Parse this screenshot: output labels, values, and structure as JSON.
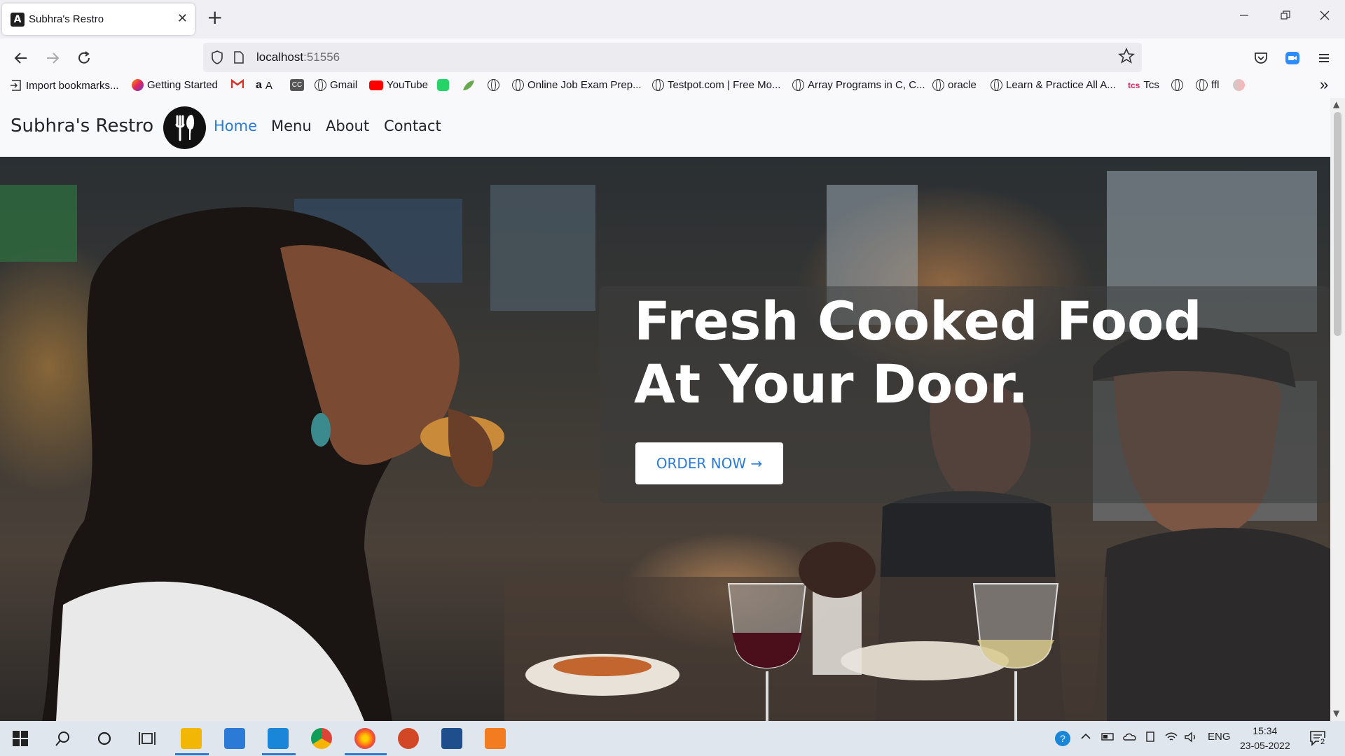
{
  "browser": {
    "tab_title": "Subhra's Restro",
    "tab_close": "✕",
    "new_tab": "+",
    "url_host": "localhost",
    "url_port": ":51556",
    "bookmarks": [
      {
        "label": "Import bookmarks...",
        "icon": "import-icon"
      },
      {
        "label": "Getting Started",
        "icon": "firefox-icon"
      },
      {
        "label": "",
        "icon": "gmail-icon"
      },
      {
        "label": "A",
        "icon": "amazon-icon"
      },
      {
        "label": "",
        "icon": "cc-icon"
      },
      {
        "label": "Gmail",
        "icon": "globe-icon"
      },
      {
        "label": "YouTube",
        "icon": "youtube-icon"
      },
      {
        "label": "",
        "icon": "whatsapp-icon"
      },
      {
        "label": "",
        "icon": "leaf-icon"
      },
      {
        "label": "",
        "icon": "globe-icon"
      },
      {
        "label": "Online Job Exam Prep...",
        "icon": "globe-icon"
      },
      {
        "label": "Testpot.com | Free Mo...",
        "icon": "globe-icon"
      },
      {
        "label": "Array Programs in C, C...",
        "icon": "globe-icon"
      },
      {
        "label": "oracle",
        "icon": "globe-icon"
      },
      {
        "label": "Learn & Practice All A...",
        "icon": "globe-icon"
      },
      {
        "label": "Tcs",
        "icon": "tcs-icon"
      },
      {
        "label": "",
        "icon": "globe-icon"
      },
      {
        "label": "ffl",
        "icon": "globe-icon"
      }
    ],
    "overflow": "»"
  },
  "site": {
    "brand": "Subhra's Restro",
    "nav": [
      "Home",
      "Menu",
      "About",
      "Contact"
    ],
    "hero_line1": "Fresh Cooked Food",
    "hero_line2": "At Your Door.",
    "order_button": "ORDER NOW →"
  },
  "taskbar": {
    "lang": "ENG",
    "time": "15:34",
    "date": "23-05-2022",
    "notifications": "2"
  },
  "colors": {
    "accent": "#2b7bd6",
    "navbar_bg": "#f8f9fa"
  }
}
